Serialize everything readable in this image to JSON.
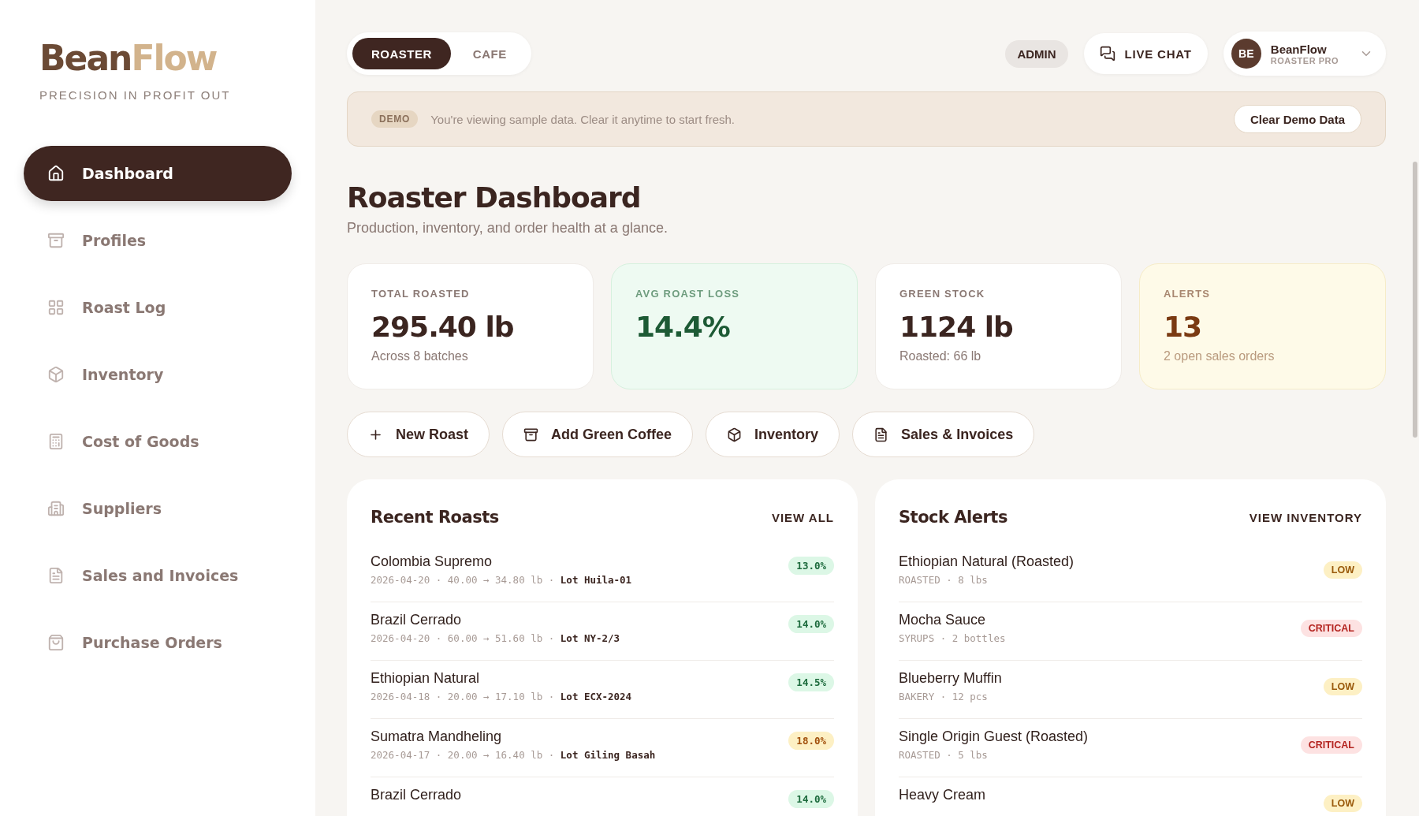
{
  "brand": {
    "name_part_1": "Bean",
    "name_part_2": "Flow",
    "tagline": "PRECISION IN PROFIT OUT"
  },
  "nav": [
    {
      "label": "Dashboard",
      "selected": true
    },
    {
      "label": "Profiles",
      "selected": false
    },
    {
      "label": "Roast Log",
      "selected": false
    },
    {
      "label": "Inventory",
      "selected": false
    },
    {
      "label": "Cost of Goods",
      "selected": false
    },
    {
      "label": "Suppliers",
      "selected": false
    },
    {
      "label": "Sales and Invoices",
      "selected": false
    },
    {
      "label": "Purchase Orders",
      "selected": false
    }
  ],
  "mode_tabs": [
    {
      "label": "ROASTER",
      "selected": true
    },
    {
      "label": "CAFE",
      "selected": false
    }
  ],
  "role_badge": "ADMIN",
  "live_chat": "LIVE CHAT",
  "user": {
    "initials": "BE",
    "name": "BeanFlow",
    "plan": "ROASTER PRO"
  },
  "banner": {
    "badge": "DEMO",
    "message": "You're viewing sample data. Clear it anytime to start fresh.",
    "button": "Clear Demo Data"
  },
  "page": {
    "title": "Roaster Dashboard",
    "subtitle": "Production, inventory, and order health at a glance."
  },
  "stats": [
    {
      "label": "TOTAL ROASTED",
      "value": "295.40 lb",
      "note": "Across 8 batches",
      "kind": "plain"
    },
    {
      "label": "AVG ROAST LOSS",
      "value": "14.4%",
      "kind": "good"
    },
    {
      "label": "GREEN STOCK",
      "value": "1124 lb",
      "note": "Roasted: 66 lb",
      "kind": "plain"
    },
    {
      "label": "ALERTS",
      "value": "13",
      "note": "2 open sales orders",
      "kind": "warning"
    }
  ],
  "actions": [
    "New Roast",
    "Add Green Coffee",
    "Inventory",
    "Sales & Invoices"
  ],
  "recent_roasts": {
    "title": "Recent Roasts",
    "link": "VIEW ALL",
    "rows": [
      {
        "name": "Colombia Supremo",
        "meta": "2026-04-20 · 40.00 → 34.80 lb ·",
        "lot": "Lot Huila-01",
        "loss": "13.0%",
        "kind": "ok"
      },
      {
        "name": "Brazil Cerrado",
        "meta": "2026-04-20 · 60.00 → 51.60 lb ·",
        "lot": "Lot NY-2/3",
        "loss": "14.0%",
        "kind": "ok"
      },
      {
        "name": "Ethiopian Natural",
        "meta": "2026-04-18 · 20.00 → 17.10 lb ·",
        "lot": "Lot ECX-2024",
        "loss": "14.5%",
        "kind": "ok"
      },
      {
        "name": "Sumatra Mandheling",
        "meta": "2026-04-17 · 20.00 → 16.40 lb ·",
        "lot": "Lot Giling Basah",
        "loss": "18.0%",
        "kind": "high"
      },
      {
        "name": "Brazil Cerrado",
        "loss": "14.0%",
        "kind": "ok"
      }
    ]
  },
  "stock_alerts": {
    "title": "Stock Alerts",
    "link": "VIEW INVENTORY",
    "rows": [
      {
        "name": "Ethiopian Natural (Roasted)",
        "meta": "ROASTED · 8 lbs",
        "badge": "LOW",
        "kind": "low"
      },
      {
        "name": "Mocha Sauce",
        "meta": "SYRUPS · 2 bottles",
        "badge": "CRITICAL",
        "kind": "critical"
      },
      {
        "name": "Blueberry Muffin",
        "meta": "BAKERY · 12 pcs",
        "badge": "LOW",
        "kind": "low"
      },
      {
        "name": "Single Origin Guest (Roasted)",
        "meta": "ROASTED · 5 lbs",
        "badge": "CRITICAL",
        "kind": "critical"
      },
      {
        "name": "Heavy Cream",
        "badge": "LOW",
        "kind": "low"
      }
    ]
  }
}
